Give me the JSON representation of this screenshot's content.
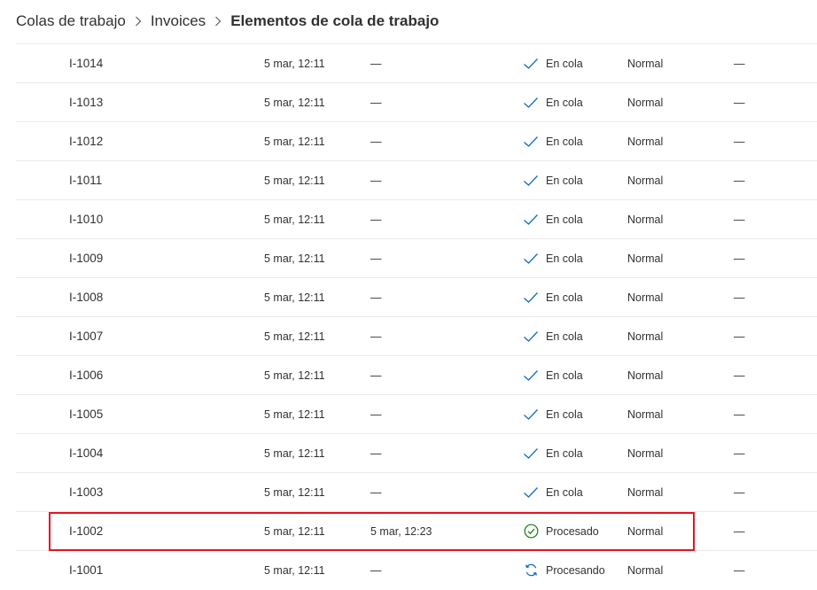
{
  "breadcrumb": {
    "items": [
      "Colas de trabajo",
      "Invoices"
    ],
    "current": "Elementos de cola de trabajo"
  },
  "colors": {
    "accent": "#0f6cbd",
    "success": "#107c10",
    "highlight": "#e81123",
    "divider": "#edebe9"
  },
  "rows": [
    {
      "id": "I-1014",
      "created": "5 mar, 12:11",
      "processed": "—",
      "status": "En cola",
      "status_icon": "checkmark-icon",
      "priority": "Normal",
      "extra": "—"
    },
    {
      "id": "I-1013",
      "created": "5 mar, 12:11",
      "processed": "—",
      "status": "En cola",
      "status_icon": "checkmark-icon",
      "priority": "Normal",
      "extra": "—"
    },
    {
      "id": "I-1012",
      "created": "5 mar, 12:11",
      "processed": "—",
      "status": "En cola",
      "status_icon": "checkmark-icon",
      "priority": "Normal",
      "extra": "—"
    },
    {
      "id": "I-1011",
      "created": "5 mar, 12:11",
      "processed": "—",
      "status": "En cola",
      "status_icon": "checkmark-icon",
      "priority": "Normal",
      "extra": "—"
    },
    {
      "id": "I-1010",
      "created": "5 mar, 12:11",
      "processed": "—",
      "status": "En cola",
      "status_icon": "checkmark-icon",
      "priority": "Normal",
      "extra": "—"
    },
    {
      "id": "I-1009",
      "created": "5 mar, 12:11",
      "processed": "—",
      "status": "En cola",
      "status_icon": "checkmark-icon",
      "priority": "Normal",
      "extra": "—"
    },
    {
      "id": "I-1008",
      "created": "5 mar, 12:11",
      "processed": "—",
      "status": "En cola",
      "status_icon": "checkmark-icon",
      "priority": "Normal",
      "extra": "—"
    },
    {
      "id": "I-1007",
      "created": "5 mar, 12:11",
      "processed": "—",
      "status": "En cola",
      "status_icon": "checkmark-icon",
      "priority": "Normal",
      "extra": "—"
    },
    {
      "id": "I-1006",
      "created": "5 mar, 12:11",
      "processed": "—",
      "status": "En cola",
      "status_icon": "checkmark-icon",
      "priority": "Normal",
      "extra": "—"
    },
    {
      "id": "I-1005",
      "created": "5 mar, 12:11",
      "processed": "—",
      "status": "En cola",
      "status_icon": "checkmark-icon",
      "priority": "Normal",
      "extra": "—"
    },
    {
      "id": "I-1004",
      "created": "5 mar, 12:11",
      "processed": "—",
      "status": "En cola",
      "status_icon": "checkmark-icon",
      "priority": "Normal",
      "extra": "—"
    },
    {
      "id": "I-1003",
      "created": "5 mar, 12:11",
      "processed": "—",
      "status": "En cola",
      "status_icon": "checkmark-icon",
      "priority": "Normal",
      "extra": "—"
    },
    {
      "id": "I-1002",
      "created": "5 mar, 12:11",
      "processed": "5 mar, 12:23",
      "status": "Procesado",
      "status_icon": "check-circle-icon",
      "priority": "Normal",
      "extra": "—"
    },
    {
      "id": "I-1001",
      "created": "5 mar, 12:11",
      "processed": "—",
      "status": "Procesando",
      "status_icon": "sync-icon",
      "priority": "Normal",
      "extra": "—"
    }
  ]
}
